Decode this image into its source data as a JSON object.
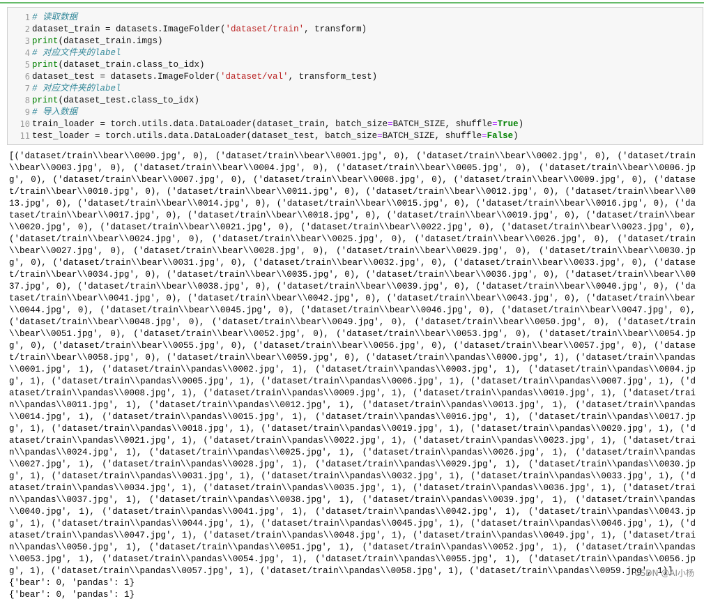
{
  "code_cell": {
    "line_numbers": [
      "1",
      "2",
      "3",
      "4",
      "5",
      "6",
      "7",
      "8",
      "9",
      "10",
      "11"
    ],
    "lines": [
      [
        {
          "t": "# 读取数据",
          "c": "comment"
        }
      ],
      [
        {
          "t": "dataset_train = datasets.ImageFolder(",
          "c": ""
        },
        {
          "t": "'dataset/train'",
          "c": "str"
        },
        {
          "t": ", transform)",
          "c": ""
        }
      ],
      [
        {
          "t": "print",
          "c": "kw-print"
        },
        {
          "t": "(dataset_train.imgs)",
          "c": ""
        }
      ],
      [
        {
          "t": "# 对应文件夹的label",
          "c": "comment"
        }
      ],
      [
        {
          "t": "print",
          "c": "kw-print"
        },
        {
          "t": "(dataset_train.class_to_idx)",
          "c": ""
        }
      ],
      [
        {
          "t": "dataset_test = datasets.ImageFolder(",
          "c": ""
        },
        {
          "t": "'dataset/val'",
          "c": "str"
        },
        {
          "t": ", transform_test)",
          "c": ""
        }
      ],
      [
        {
          "t": "# 对应文件夹的label",
          "c": "comment"
        }
      ],
      [
        {
          "t": "print",
          "c": "kw-print"
        },
        {
          "t": "(dataset_test.class_to_idx)",
          "c": ""
        }
      ],
      [
        {
          "t": "# 导入数据",
          "c": "comment"
        }
      ],
      [
        {
          "t": "train_loader = torch.utils.data.DataLoader(dataset_train, batch_size",
          "c": ""
        },
        {
          "t": "=",
          "c": "eq"
        },
        {
          "t": "BATCH_SIZE, shuffle",
          "c": ""
        },
        {
          "t": "=",
          "c": "eq"
        },
        {
          "t": "True",
          "c": "bool"
        },
        {
          "t": ")",
          "c": ""
        }
      ],
      [
        {
          "t": "test_loader = torch.utils.data.DataLoader(dataset_test, batch_size",
          "c": ""
        },
        {
          "t": "=",
          "c": "eq"
        },
        {
          "t": "BATCH_SIZE, shuffle",
          "c": ""
        },
        {
          "t": "=",
          "c": "eq"
        },
        {
          "t": "False",
          "c": "bool"
        },
        {
          "t": ")",
          "c": ""
        }
      ]
    ]
  },
  "output": {
    "imgs_list": "[('dataset/train\\\\bear\\\\0000.jpg', 0), ('dataset/train\\\\bear\\\\0001.jpg', 0), ('dataset/train\\\\bear\\\\0002.jpg', 0), ('dataset/train\\\\bear\\\\0003.jpg', 0), ('dataset/train\\\\bear\\\\0004.jpg', 0), ('dataset/train\\\\bear\\\\0005.jpg', 0), ('dataset/train\\\\bear\\\\0006.jpg', 0), ('dataset/train\\\\bear\\\\0007.jpg', 0), ('dataset/train\\\\bear\\\\0008.jpg', 0), ('dataset/train\\\\bear\\\\0009.jpg', 0), ('dataset/train\\\\bear\\\\0010.jpg', 0), ('dataset/train\\\\bear\\\\0011.jpg', 0), ('dataset/train\\\\bear\\\\0012.jpg', 0), ('dataset/train\\\\bear\\\\0013.jpg', 0), ('dataset/train\\\\bear\\\\0014.jpg', 0), ('dataset/train\\\\bear\\\\0015.jpg', 0), ('dataset/train\\\\bear\\\\0016.jpg', 0), ('dataset/train\\\\bear\\\\0017.jpg', 0), ('dataset/train\\\\bear\\\\0018.jpg', 0), ('dataset/train\\\\bear\\\\0019.jpg', 0), ('dataset/train\\\\bear\\\\0020.jpg', 0), ('dataset/train\\\\bear\\\\0021.jpg', 0), ('dataset/train\\\\bear\\\\0022.jpg', 0), ('dataset/train\\\\bear\\\\0023.jpg', 0), ('dataset/train\\\\bear\\\\0024.jpg', 0), ('dataset/train\\\\bear\\\\0025.jpg', 0), ('dataset/train\\\\bear\\\\0026.jpg', 0), ('dataset/train\\\\bear\\\\0027.jpg', 0), ('dataset/train\\\\bear\\\\0028.jpg', 0), ('dataset/train\\\\bear\\\\0029.jpg', 0), ('dataset/train\\\\bear\\\\0030.jpg', 0), ('dataset/train\\\\bear\\\\0031.jpg', 0), ('dataset/train\\\\bear\\\\0032.jpg', 0), ('dataset/train\\\\bear\\\\0033.jpg', 0), ('dataset/train\\\\bear\\\\0034.jpg', 0), ('dataset/train\\\\bear\\\\0035.jpg', 0), ('dataset/train\\\\bear\\\\0036.jpg', 0), ('dataset/train\\\\bear\\\\0037.jpg', 0), ('dataset/train\\\\bear\\\\0038.jpg', 0), ('dataset/train\\\\bear\\\\0039.jpg', 0), ('dataset/train\\\\bear\\\\0040.jpg', 0), ('dataset/train\\\\bear\\\\0041.jpg', 0), ('dataset/train\\\\bear\\\\0042.jpg', 0), ('dataset/train\\\\bear\\\\0043.jpg', 0), ('dataset/train\\\\bear\\\\0044.jpg', 0), ('dataset/train\\\\bear\\\\0045.jpg', 0), ('dataset/train\\\\bear\\\\0046.jpg', 0), ('dataset/train\\\\bear\\\\0047.jpg', 0), ('dataset/train\\\\bear\\\\0048.jpg', 0), ('dataset/train\\\\bear\\\\0049.jpg', 0), ('dataset/train\\\\bear\\\\0050.jpg', 0), ('dataset/train\\\\bear\\\\0051.jpg', 0), ('dataset/train\\\\bear\\\\0052.jpg', 0), ('dataset/train\\\\bear\\\\0053.jpg', 0), ('dataset/train\\\\bear\\\\0054.jpg', 0), ('dataset/train\\\\bear\\\\0055.jpg', 0), ('dataset/train\\\\bear\\\\0056.jpg', 0), ('dataset/train\\\\bear\\\\0057.jpg', 0), ('dataset/train\\\\bear\\\\0058.jpg', 0), ('dataset/train\\\\bear\\\\0059.jpg', 0), ('dataset/train\\\\pandas\\\\0000.jpg', 1), ('dataset/train\\\\pandas\\\\0001.jpg', 1), ('dataset/train\\\\pandas\\\\0002.jpg', 1), ('dataset/train\\\\pandas\\\\0003.jpg', 1), ('dataset/train\\\\pandas\\\\0004.jpg', 1), ('dataset/train\\\\pandas\\\\0005.jpg', 1), ('dataset/train\\\\pandas\\\\0006.jpg', 1), ('dataset/train\\\\pandas\\\\0007.jpg', 1), ('dataset/train\\\\pandas\\\\0008.jpg', 1), ('dataset/train\\\\pandas\\\\0009.jpg', 1), ('dataset/train\\\\pandas\\\\0010.jpg', 1), ('dataset/train\\\\pandas\\\\0011.jpg', 1), ('dataset/train\\\\pandas\\\\0012.jpg', 1), ('dataset/train\\\\pandas\\\\0013.jpg', 1), ('dataset/train\\\\pandas\\\\0014.jpg', 1), ('dataset/train\\\\pandas\\\\0015.jpg', 1), ('dataset/train\\\\pandas\\\\0016.jpg', 1), ('dataset/train\\\\pandas\\\\0017.jpg', 1), ('dataset/train\\\\pandas\\\\0018.jpg', 1), ('dataset/train\\\\pandas\\\\0019.jpg', 1), ('dataset/train\\\\pandas\\\\0020.jpg', 1), ('dataset/train\\\\pandas\\\\0021.jpg', 1), ('dataset/train\\\\pandas\\\\0022.jpg', 1), ('dataset/train\\\\pandas\\\\0023.jpg', 1), ('dataset/train\\\\pandas\\\\0024.jpg', 1), ('dataset/train\\\\pandas\\\\0025.jpg', 1), ('dataset/train\\\\pandas\\\\0026.jpg', 1), ('dataset/train\\\\pandas\\\\0027.jpg', 1), ('dataset/train\\\\pandas\\\\0028.jpg', 1), ('dataset/train\\\\pandas\\\\0029.jpg', 1), ('dataset/train\\\\pandas\\\\0030.jpg', 1), ('dataset/train\\\\pandas\\\\0031.jpg', 1), ('dataset/train\\\\pandas\\\\0032.jpg', 1), ('dataset/train\\\\pandas\\\\0033.jpg', 1), ('dataset/train\\\\pandas\\\\0034.jpg', 1), ('dataset/train\\\\pandas\\\\0035.jpg', 1), ('dataset/train\\\\pandas\\\\0036.jpg', 1), ('dataset/train\\\\pandas\\\\0037.jpg', 1), ('dataset/train\\\\pandas\\\\0038.jpg', 1), ('dataset/train\\\\pandas\\\\0039.jpg', 1), ('dataset/train\\\\pandas\\\\0040.jpg', 1), ('dataset/train\\\\pandas\\\\0041.jpg', 1), ('dataset/train\\\\pandas\\\\0042.jpg', 1), ('dataset/train\\\\pandas\\\\0043.jpg', 1), ('dataset/train\\\\pandas\\\\0044.jpg', 1), ('dataset/train\\\\pandas\\\\0045.jpg', 1), ('dataset/train\\\\pandas\\\\0046.jpg', 1), ('dataset/train\\\\pandas\\\\0047.jpg', 1), ('dataset/train\\\\pandas\\\\0048.jpg', 1), ('dataset/train\\\\pandas\\\\0049.jpg', 1), ('dataset/train\\\\pandas\\\\0050.jpg', 1), ('dataset/train\\\\pandas\\\\0051.jpg', 1), ('dataset/train\\\\pandas\\\\0052.jpg', 1), ('dataset/train\\\\pandas\\\\0053.jpg', 1), ('dataset/train\\\\pandas\\\\0054.jpg', 1), ('dataset/train\\\\pandas\\\\0055.jpg', 1), ('dataset/train\\\\pandas\\\\0056.jpg', 1), ('dataset/train\\\\pandas\\\\0057.jpg', 1), ('dataset/train\\\\pandas\\\\0058.jpg', 1), ('dataset/train\\\\pandas\\\\0059.jpg', 1)]",
    "train_class_to_idx": "{'bear': 0, 'pandas': 1}",
    "test_class_to_idx": "{'bear': 0, 'pandas': 1}"
  },
  "watermark": "CSDN @AI小杨"
}
